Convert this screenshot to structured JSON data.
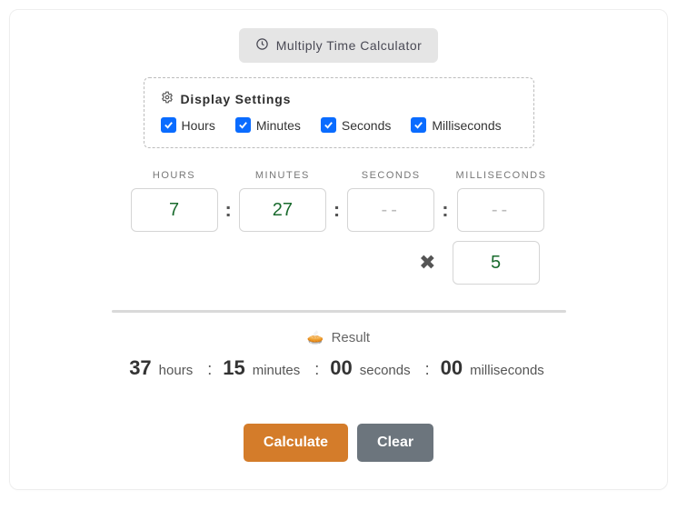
{
  "title": "Multiply Time Calculator",
  "settings": {
    "header": "Display Settings",
    "options": {
      "hours": "Hours",
      "minutes": "Minutes",
      "seconds": "Seconds",
      "milliseconds": "Milliseconds"
    }
  },
  "inputs": {
    "labels": {
      "hours": "HOURS",
      "minutes": "MINUTES",
      "seconds": "SECONDS",
      "milliseconds": "MILLISECONDS"
    },
    "values": {
      "hours": "7",
      "minutes": "27",
      "seconds": "",
      "milliseconds": "",
      "multiplier": "5"
    },
    "placeholder": "--"
  },
  "result": {
    "label": "Result",
    "hours_val": "37",
    "hours_unit": "hours",
    "minutes_val": "15",
    "minutes_unit": "minutes",
    "seconds_val": "00",
    "seconds_unit": "seconds",
    "ms_val": "00",
    "ms_unit": "milliseconds",
    "sep": ":"
  },
  "buttons": {
    "calculate": "Calculate",
    "clear": "Clear"
  }
}
